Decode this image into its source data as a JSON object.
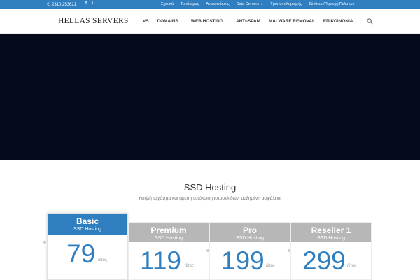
{
  "topbar": {
    "phone": "2310 253621",
    "phone_icon": "phone-icon",
    "social": [
      "f",
      "t"
    ],
    "links": [
      {
        "label": "Σχετικά"
      },
      {
        "label": "Τα νέα μας"
      },
      {
        "label": "Ανακοινώσεις"
      },
      {
        "label": "Data Centers",
        "dropdown": true
      },
      {
        "label": "Τρόποι πληρωμής"
      },
      {
        "label": "Σύνδεση/Περιοχή Πελατών"
      }
    ]
  },
  "header": {
    "logo": "HELLAS SERVERS",
    "nav": [
      {
        "label": "VS"
      },
      {
        "label": "DOMAINS",
        "dropdown": true
      },
      {
        "label": "WEB HOSTING",
        "dropdown": true
      },
      {
        "label": "ANTI-SPAM"
      },
      {
        "label": "MALWARE REMOVAL"
      },
      {
        "label": "ΕΠΙΚΟΙΝΩΝΙΑ"
      }
    ],
    "search_icon": "search-icon"
  },
  "colors": {
    "accent": "#2f7fc0",
    "hero": "#050a1a",
    "plan_gray": "#b7b7b7"
  },
  "section": {
    "title": "SSD Hosting",
    "subtitle": "Υψηλή ταχύτητα και άμεση απόκριση ιστοσελίδων, αυξημένη ασφάλεια."
  },
  "plans": [
    {
      "name": "Basic",
      "sub": "SSD Hosting",
      "price": "79",
      "per": "/έτος"
    },
    {
      "name": "Premium",
      "sub": "SSD Hosting",
      "price": "119",
      "per": "/έτος"
    },
    {
      "name": "Pro",
      "sub": "SSD Hosting",
      "price": "199",
      "per": "/έτος"
    },
    {
      "name": "Reseller 1",
      "sub": "SSD Hosting",
      "price": "299",
      "per": "/έτος"
    }
  ]
}
